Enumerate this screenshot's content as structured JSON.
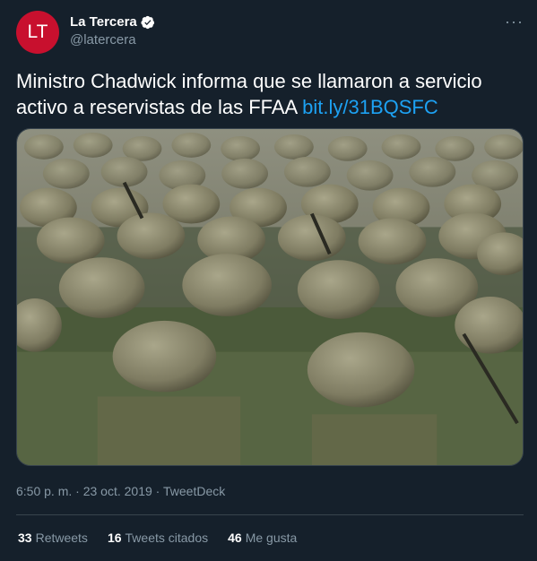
{
  "account": {
    "avatar_text": "LT",
    "display_name": "La Tercera",
    "handle": "@latercera",
    "brand_color": "#c8102e"
  },
  "menu": {
    "more_icon": "more-horizontal-icon",
    "more_glyph": "···"
  },
  "tweet": {
    "text_part1": "Ministro Chadwick informa que se llamaron a servicio activo a reservistas de las FFAA ",
    "link_text": "bit.ly/31BQSFC"
  },
  "meta": {
    "time": "6:50 p. m.",
    "separator": "·",
    "date": "23 oct. 2019",
    "source": "TweetDeck"
  },
  "stats": [
    {
      "count": "33",
      "label": "Retweets"
    },
    {
      "count": "16",
      "label": "Tweets citados"
    },
    {
      "count": "46",
      "label": "Me gusta"
    }
  ],
  "colors": {
    "background": "#15202b",
    "link": "#1da1f2",
    "muted": "#8899a6"
  }
}
